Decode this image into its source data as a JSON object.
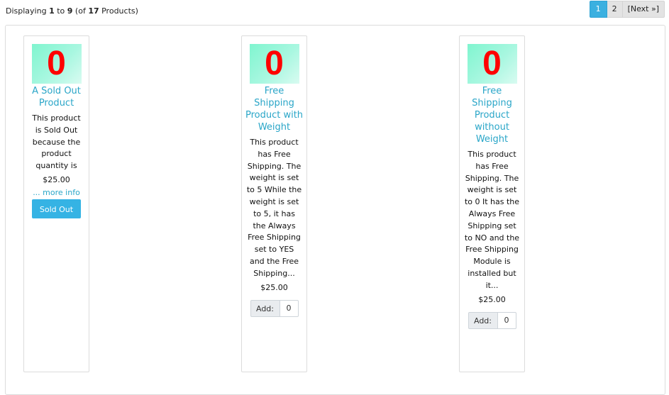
{
  "listing": {
    "prefix": "Displaying ",
    "from": "1",
    "to_word": " to ",
    "to": "9",
    "of_open": " (of ",
    "total": "17",
    "suffix": " Products)"
  },
  "pagination": {
    "pages": [
      "1",
      "2"
    ],
    "active": "1",
    "next_label": "[Next »]"
  },
  "products": [
    {
      "image_text": "0",
      "name": "A Sold Out Product",
      "description": "This product is Sold Out because the product quantity is",
      "price": "$25.00",
      "more_info": "... more info",
      "button_label": "Sold Out"
    },
    {
      "image_text": "0",
      "name": "Free Shipping Product with Weight",
      "description": "This product has Free Shipping. The weight is set to 5 While the weight is set to 5, it has the Always Free Shipping set to YES and the Free Shipping...",
      "price": "$25.00",
      "add_label": "Add:",
      "qty": "0"
    },
    {
      "image_text": "0",
      "name": "Free Shipping Product without Weight",
      "description": "This product has Free Shipping. The weight is set to 0 It has the Always Free Shipping set to NO and the Free Shipping Module is installed but it...",
      "price": "$25.00",
      "add_label": "Add:",
      "qty": "0"
    }
  ],
  "colors": {
    "accent": "#35b3e4",
    "link": "#2aa6c8",
    "image_digit": "#ff0000",
    "image_bg": "#7ff5cf"
  }
}
